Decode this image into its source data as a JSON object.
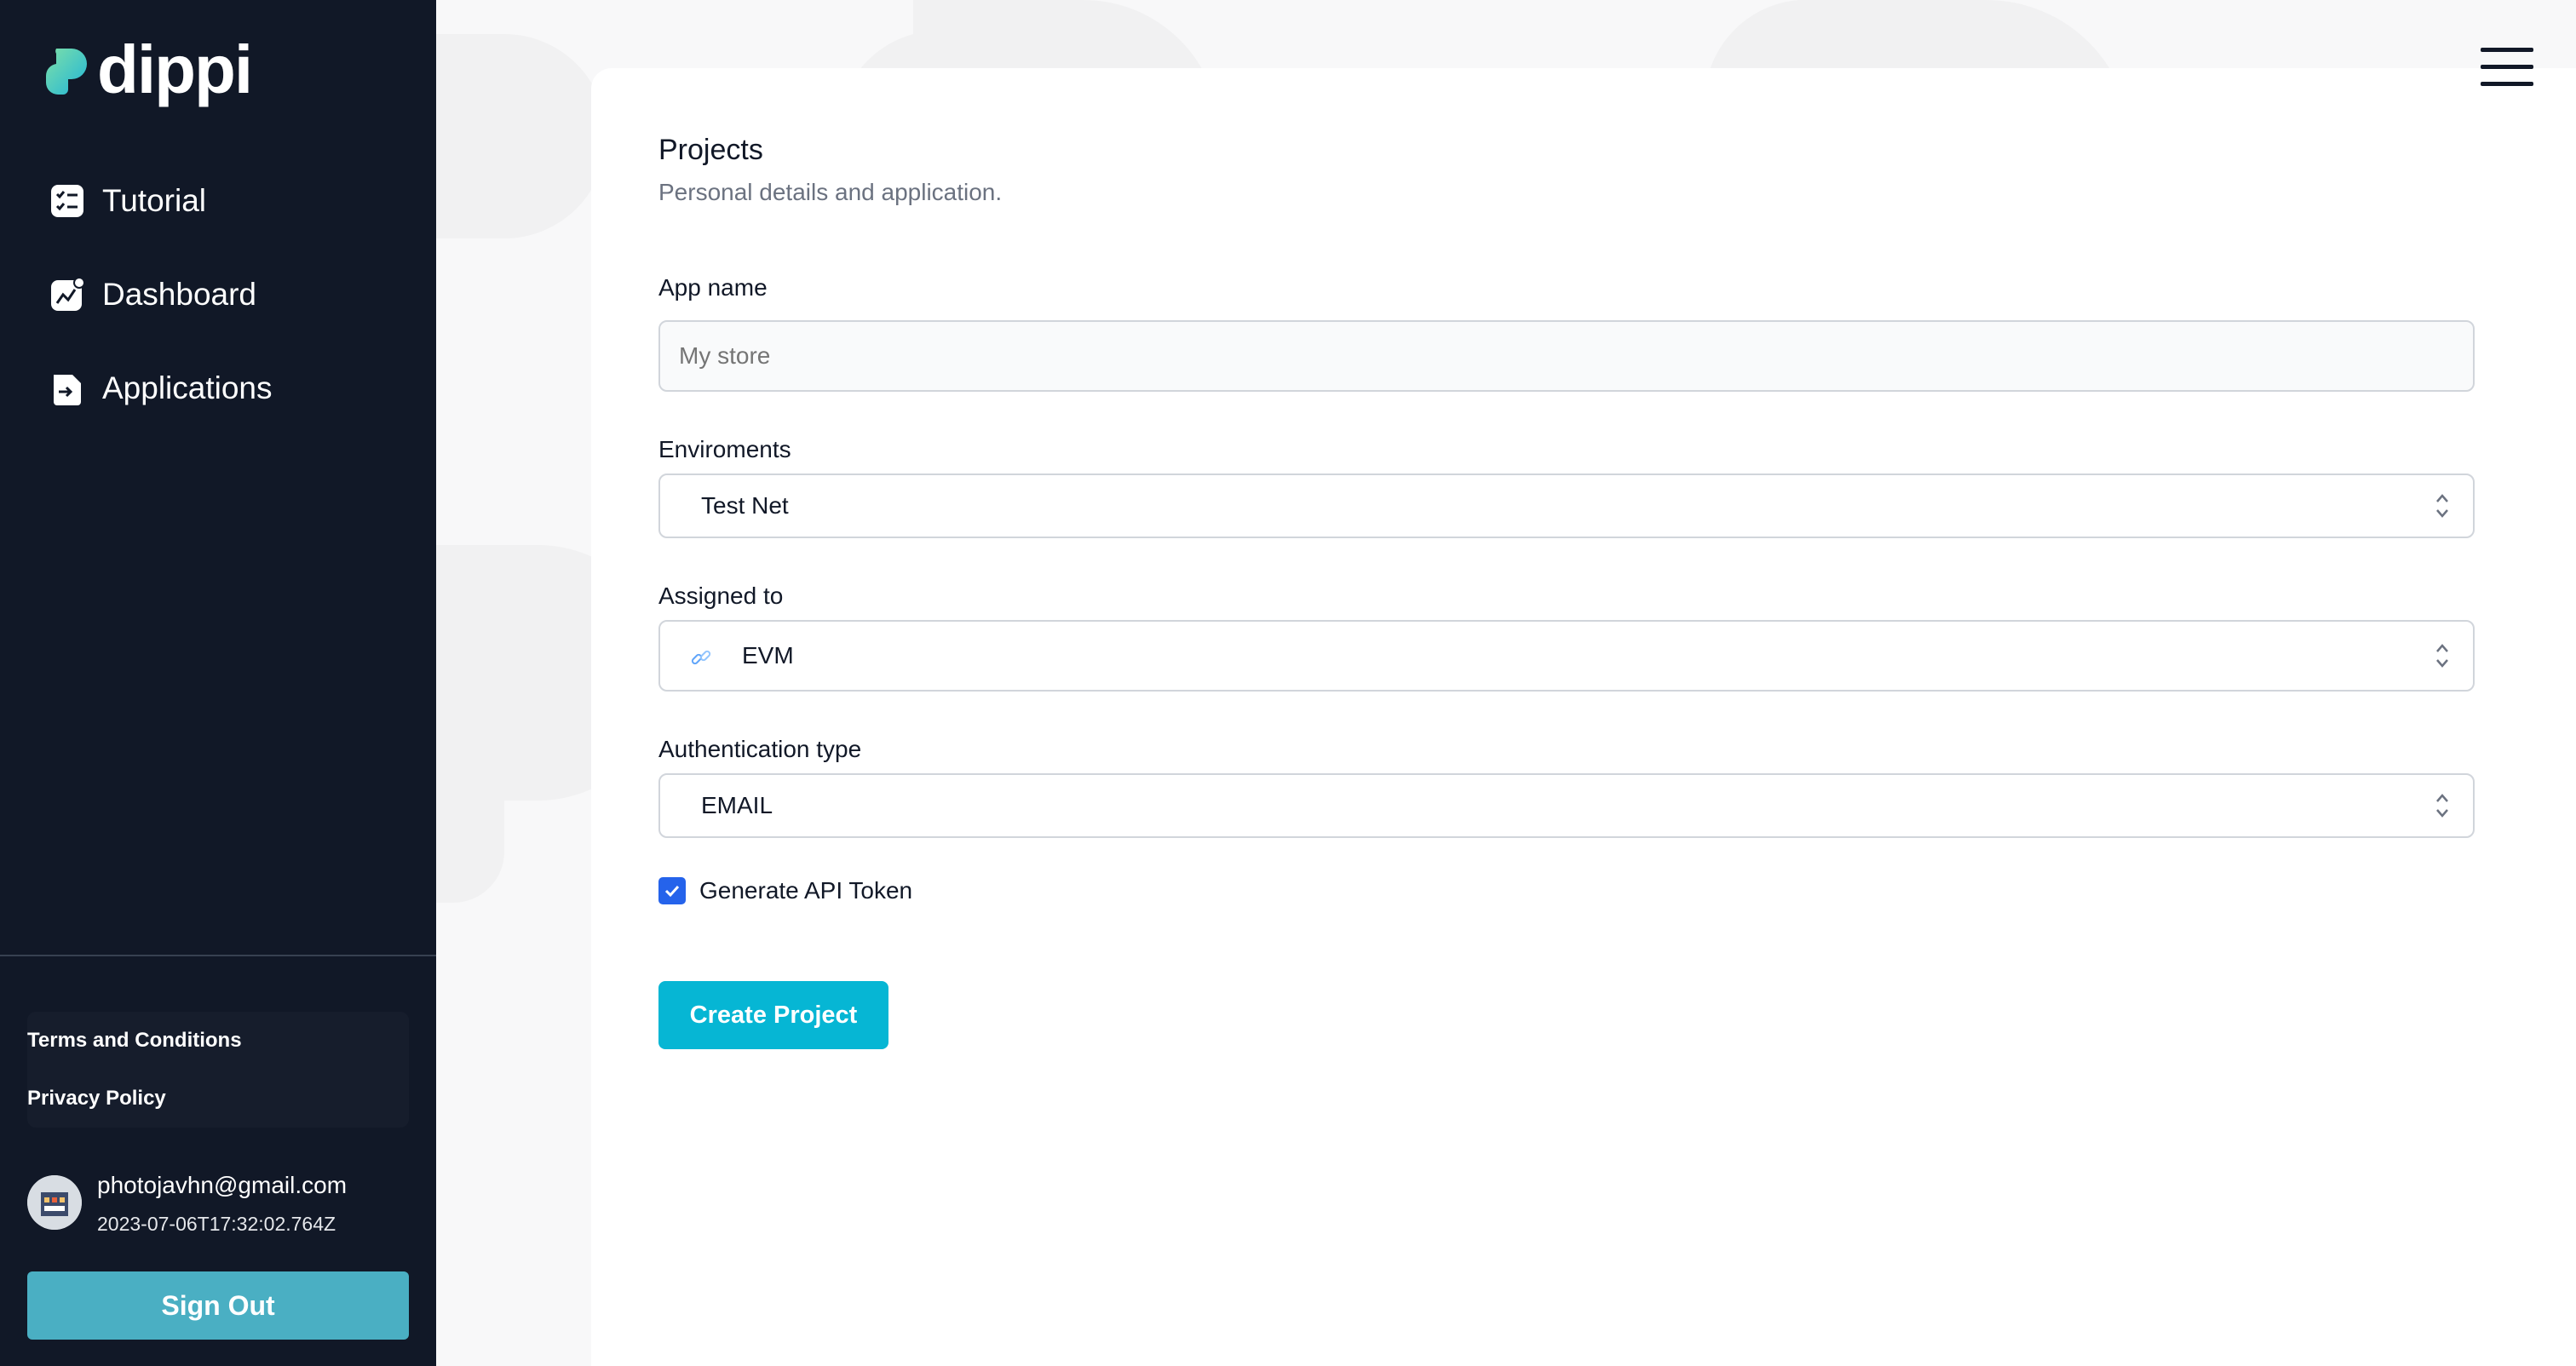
{
  "brand": {
    "name": "dippi",
    "accent": "#4ecdc4"
  },
  "sidebar": {
    "items": [
      {
        "label": "Tutorial",
        "icon": "checklist-icon"
      },
      {
        "label": "Dashboard",
        "icon": "chart-icon"
      },
      {
        "label": "Applications",
        "icon": "file-arrow-icon"
      }
    ],
    "legal": {
      "terms": "Terms and Conditions",
      "privacy": "Privacy Policy"
    },
    "user": {
      "email": "photojavhn@gmail.com",
      "timestamp": "2023-07-06T17:32:02.764Z"
    },
    "signout_label": "Sign Out"
  },
  "header": {
    "menu_icon": "hamburger-icon"
  },
  "form": {
    "title": "Projects",
    "subtitle": "Personal details and application.",
    "app_name": {
      "label": "App name",
      "placeholder": "My store",
      "value": ""
    },
    "environments": {
      "label": "Enviroments",
      "value": "Test Net"
    },
    "assigned_to": {
      "label": "Assigned to",
      "value": "EVM",
      "icon": "chain-link-icon"
    },
    "auth_type": {
      "label": "Authentication type",
      "value": "EMAIL"
    },
    "api_token": {
      "label": "Generate API Token",
      "checked": true
    },
    "submit_label": "Create Project"
  },
  "colors": {
    "sidebar_bg": "#111827",
    "signout_bg": "#4aafc3",
    "primary_button": "#06b6d4",
    "checkbox": "#2563eb"
  }
}
